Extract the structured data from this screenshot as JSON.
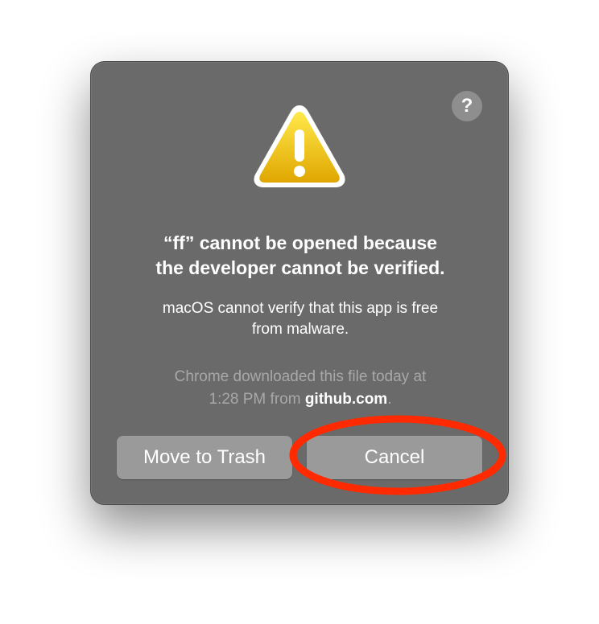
{
  "dialog": {
    "title_line1": "“ff” cannot be opened because",
    "title_line2": "the developer cannot be verified.",
    "message_line1": "macOS cannot verify that this app is free",
    "message_line2": "from malware.",
    "info_line1": "Chrome downloaded this file today at",
    "info_line2_prefix": "1:28 PM from ",
    "info_domain": "github.com",
    "info_line2_suffix": ".",
    "help_label": "?",
    "icon": "warning-triangle-icon"
  },
  "buttons": {
    "move_to_trash": "Move to Trash",
    "cancel": "Cancel"
  },
  "annotation": {
    "shape": "ellipse",
    "color": "#ff2a00",
    "target": "cancel-button"
  },
  "colors": {
    "dialog_bg": "#6a6a6a",
    "button_bg": "#9a9a9a",
    "warning_yellow": "#f1c40f"
  }
}
